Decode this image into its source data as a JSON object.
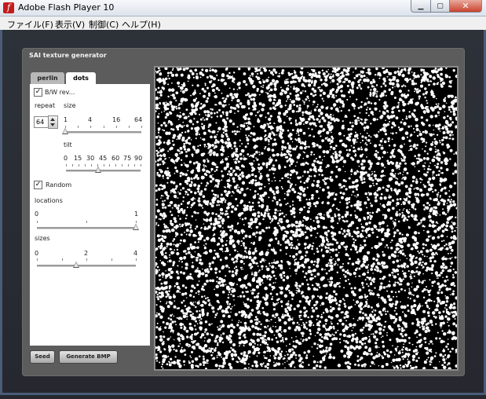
{
  "window": {
    "title": "Adobe Flash Player 10",
    "controls": {
      "minimize": "▁",
      "maximize": "▢",
      "close": "✕"
    }
  },
  "menu": [
    "ファイル(F)",
    "表示(V)",
    "制御(C)",
    "ヘルプ(H)"
  ],
  "panel": {
    "title": "SAI texture generator",
    "tabs": [
      {
        "label": "perlin",
        "selected": false
      },
      {
        "label": "dots",
        "selected": true
      }
    ],
    "bw_reverse": {
      "label": "B/W rev...",
      "checked": true
    },
    "repeat": {
      "label": "repeat",
      "value": "64"
    },
    "size": {
      "label": "size",
      "ticks": [
        "1",
        "4",
        "16",
        "64"
      ],
      "value_fraction": 0.0
    },
    "tilt": {
      "label": "tilt",
      "ticks": [
        "0",
        "15",
        "30",
        "45",
        "60",
        "75",
        "90"
      ],
      "value_fraction": 0.43
    },
    "random": {
      "label": "Random",
      "checked": true
    },
    "locations": {
      "label": "locations",
      "ticks": [
        "0",
        "1"
      ],
      "value_fraction": 1.0
    },
    "sizes": {
      "label": "sizes",
      "ticks": [
        "0",
        "2",
        "4"
      ],
      "value_fraction": 0.4
    },
    "buttons": {
      "seed": "Seed",
      "generate": "Generate BMP"
    }
  },
  "preview": {
    "background": "#000000",
    "dot_color": "#ffffff"
  },
  "colors": {
    "panel": "#5c5c5c",
    "stage": "#2a2e35",
    "titlebar": "#e8ecf2",
    "close": "#c8432d"
  }
}
